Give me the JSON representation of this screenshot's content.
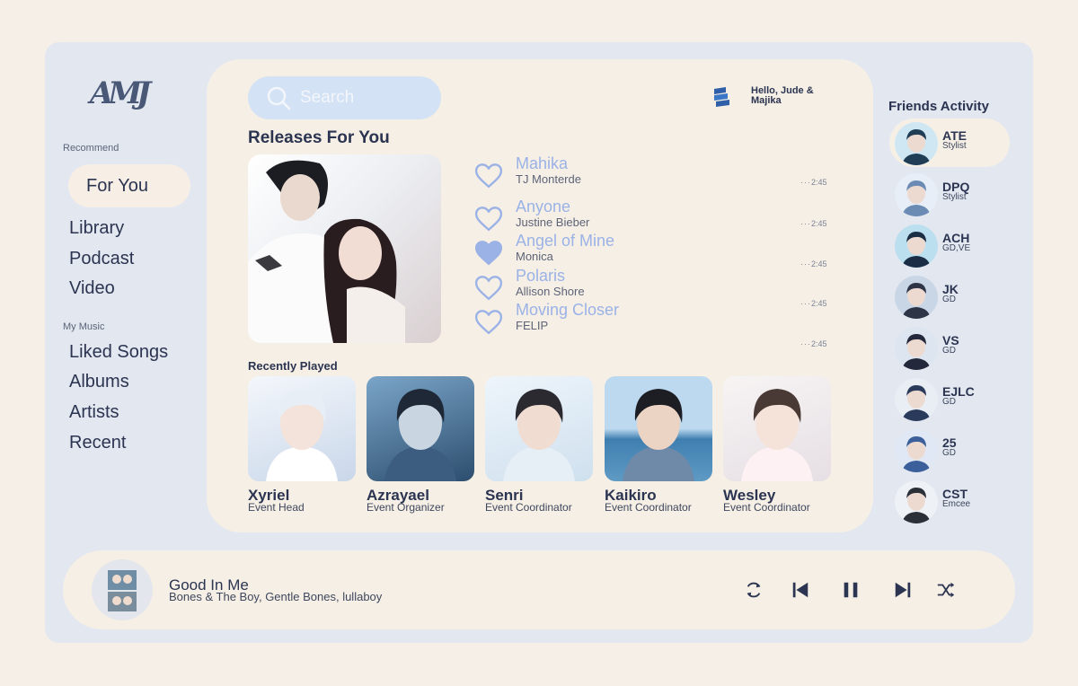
{
  "sidebar": {
    "logo": "AMJ",
    "recommend_label": "Recommend",
    "recommend_items": [
      "For You",
      "Library",
      "Podcast",
      "Video"
    ],
    "my_music_label": "My Music",
    "my_music_items": [
      "Liked Songs",
      "Albums",
      "Artists",
      "Recent"
    ]
  },
  "search": {
    "placeholder": "Search"
  },
  "greeting": "Hello, Jude & Majika",
  "releases": {
    "heading": "Releases For You",
    "songs": [
      {
        "title": "Mahika",
        "artist": "TJ Monterde",
        "duration": "2:45",
        "liked": false
      },
      {
        "title": "Anyone",
        "artist": "Justine Bieber",
        "duration": "2:45",
        "liked": false
      },
      {
        "title": "Angel of Mine",
        "artist": "Monica",
        "duration": "2:45",
        "liked": true
      },
      {
        "title": "Polaris",
        "artist": "Allison Shore",
        "duration": "2:45",
        "liked": false
      },
      {
        "title": "Moving Closer",
        "artist": "FELIP",
        "duration": "2:45",
        "liked": false
      }
    ]
  },
  "recently_played": {
    "heading": "Recently Played",
    "items": [
      {
        "name": "Xyriel",
        "role": "Event Head"
      },
      {
        "name": "Azrayael",
        "role": "Event Organizer"
      },
      {
        "name": "Senri",
        "role": "Event Coordinator"
      },
      {
        "name": "Kaikiro",
        "role": "Event Coordinator"
      },
      {
        "name": "Wesley",
        "role": "Event Coordinator"
      }
    ]
  },
  "friends": {
    "heading": "Friends Activity",
    "items": [
      {
        "name": "ATE",
        "role": "Stylist"
      },
      {
        "name": "DPQ",
        "role": "Stylist"
      },
      {
        "name": "ACH",
        "role": "GD,VE"
      },
      {
        "name": "JK",
        "role": "GD"
      },
      {
        "name": "VS",
        "role": "GD"
      },
      {
        "name": "EJLC",
        "role": "GD"
      },
      {
        "name": "25",
        "role": "GD"
      },
      {
        "name": "CST",
        "role": "Emcee"
      }
    ]
  },
  "now_playing": {
    "title": "Good In Me",
    "artist": "Bones & The Boy, Gentle Bones, lullaboy"
  },
  "colors": {
    "background": "#f5efe8",
    "panel": "#e2e7f0",
    "accent": "#9ab2e6",
    "text": "#2b3450"
  }
}
